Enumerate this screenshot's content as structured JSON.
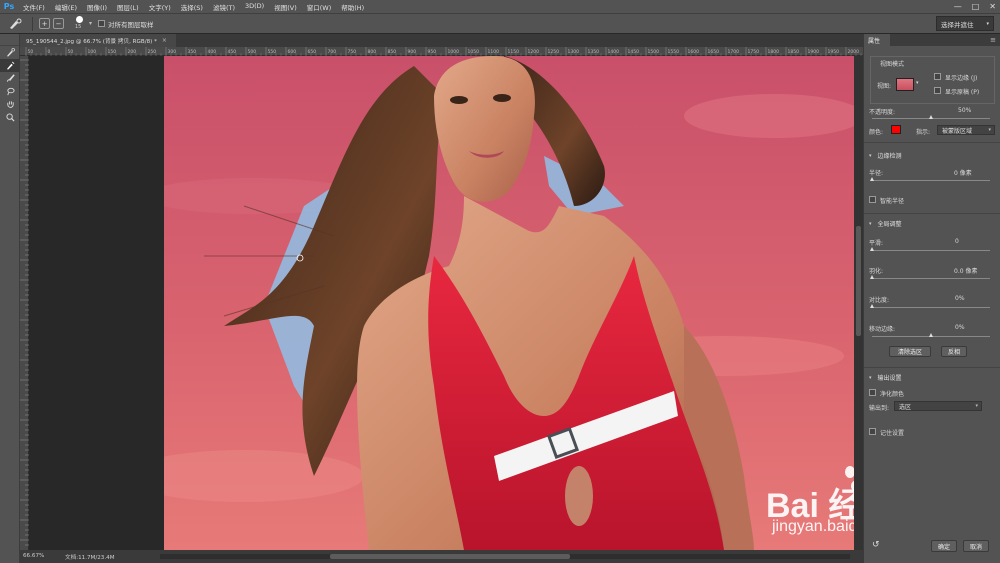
{
  "app": {
    "logo": "Ps",
    "menu": [
      "文件(F)",
      "编辑(E)",
      "图像(I)",
      "图层(L)",
      "文字(Y)",
      "选择(S)",
      "滤镜(T)",
      "3D(D)",
      "视图(V)",
      "窗口(W)",
      "帮助(H)"
    ],
    "window_controls": [
      "—",
      "□",
      "✕"
    ]
  },
  "options_bar": {
    "brush_size": "15",
    "sample_all_layers_label": "对所有图层取样",
    "select_and_mask_value": "选择并遮住"
  },
  "document": {
    "tab_title": "95_190544_2.jpg @ 66.7% (背景 拷贝, RGB/8) *",
    "tab_close": "×",
    "ruler_ticks": [
      "50",
      "0",
      "50",
      "100",
      "150",
      "200",
      "250",
      "300",
      "350",
      "400",
      "450",
      "500",
      "550",
      "600",
      "650",
      "700",
      "750",
      "800",
      "850",
      "900",
      "950",
      "1000",
      "1050",
      "1100",
      "1150",
      "1200",
      "1250",
      "1300",
      "1350",
      "1400",
      "1450",
      "1500",
      "1550",
      "1600",
      "1650",
      "1700",
      "1750",
      "1800",
      "1850",
      "1900",
      "1950",
      "2000"
    ],
    "zoom": "66.67%",
    "doc_size": "文档:11.7M/23.4M"
  },
  "watermark": {
    "brand": "Bai 经验",
    "url": "jingyan.baidu.com"
  },
  "properties_panel": {
    "tab_label": "属性",
    "view_mode": {
      "title": "视图模式",
      "view_label": "视图:",
      "show_edge_label": "显示边缘 (J)",
      "show_original_label": "显示原稿 (P)"
    },
    "opacity": {
      "label": "不透明度:",
      "value": "50%",
      "fraction": 0.5
    },
    "color_label": "颜色:",
    "overlay_color": "#ff0000",
    "indicate_label": "指示:",
    "indicate_value": "被蒙版区域",
    "edge_detection": {
      "title": "边缘检测",
      "radius_label": "半径:",
      "radius_value": "0 像素",
      "smart_radius_label": "智能半径"
    },
    "global_refinements": {
      "title": "全局调整",
      "smooth_label": "平滑:",
      "smooth_value": "0",
      "feather_label": "羽化:",
      "feather_value": "0.0 像素",
      "contrast_label": "对比度:",
      "contrast_value": "0%",
      "shift_edge_label": "移动边缘:",
      "shift_edge_value": "0%",
      "shift_edge_fraction": 0.5,
      "clear_selection_label": "清除选区",
      "invert_label": "反相"
    },
    "output_settings": {
      "title": "输出设置",
      "decontaminate_label": "净化颜色",
      "output_to_label": "输出到:",
      "output_to_value": "选区",
      "remember_label": "记住设置"
    },
    "ok_label": "确定",
    "cancel_label": "取消"
  }
}
